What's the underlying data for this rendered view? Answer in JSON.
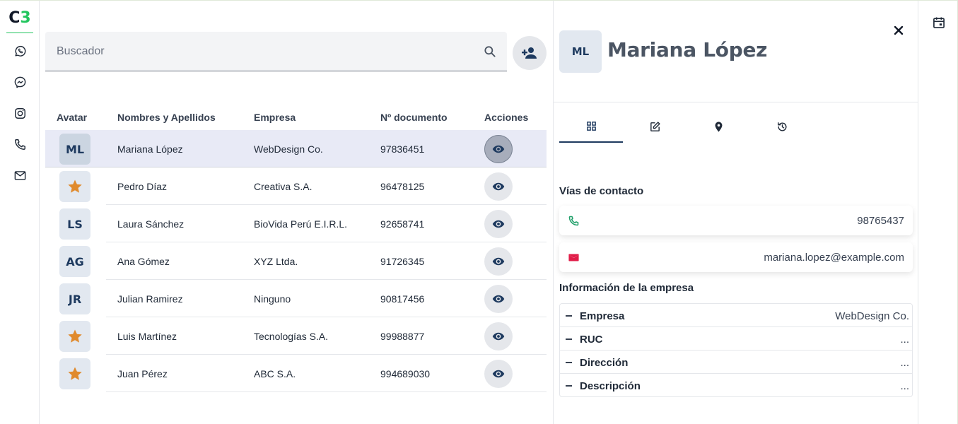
{
  "brand": {
    "logo_c": "C",
    "logo_n": "3",
    "accent": "#22c55e"
  },
  "rail": {
    "items": [
      {
        "name": "whatsapp-icon"
      },
      {
        "name": "messenger-icon"
      },
      {
        "name": "instagram-icon"
      },
      {
        "name": "phone-icon"
      },
      {
        "name": "mail-icon"
      }
    ]
  },
  "search": {
    "placeholder": "Buscador",
    "value": ""
  },
  "table": {
    "headers": {
      "avatar": "Avatar",
      "name": "Nombres y Apellidos",
      "company": "Empresa",
      "document": "Nº documento",
      "actions": "Acciones"
    },
    "rows": [
      {
        "initials": "ML",
        "name": "Mariana López",
        "company": "WebDesign Co.",
        "document": "97836451",
        "selected": true
      },
      {
        "initials": "",
        "star": true,
        "name": "Pedro Díaz",
        "company": "Creativa S.A.",
        "document": "96478125"
      },
      {
        "initials": "LS",
        "name": "Laura Sánchez",
        "company": "BioVida Perú E.I.R.L.",
        "document": "92658741"
      },
      {
        "initials": "AG",
        "name": "Ana Gómez",
        "company": "XYZ Ltda.",
        "document": "91726345"
      },
      {
        "initials": "JR",
        "name": "Julian Ramirez",
        "company": "Ninguno",
        "document": "90817456"
      },
      {
        "initials": "",
        "star": true,
        "name": "Luis Martínez",
        "company": "Tecnologías S.A.",
        "document": "99988877"
      },
      {
        "initials": "",
        "star": true,
        "name": "Juan Pérez",
        "company": "ABC S.A.",
        "document": "994689030"
      }
    ]
  },
  "detail": {
    "initials": "ML",
    "name": "Mariana López",
    "tabs": [
      "dashboard-icon",
      "edit-icon",
      "location-icon",
      "history-icon"
    ],
    "contact_title": "Vías de contacto",
    "phone": "98765437",
    "email": "mariana.lopez@example.com",
    "company_title": "Información de la empresa",
    "company_info": [
      {
        "label": "Empresa",
        "value": "WebDesign Co."
      },
      {
        "label": "RUC",
        "value": "..."
      },
      {
        "label": "Dirección",
        "value": "..."
      },
      {
        "label": "Descripción",
        "value": "..."
      }
    ]
  },
  "colors": {
    "navy": "#1e3a5f",
    "star": "#e08a2c",
    "phone_green": "#22a06b",
    "mail_red": "#e11d48"
  }
}
